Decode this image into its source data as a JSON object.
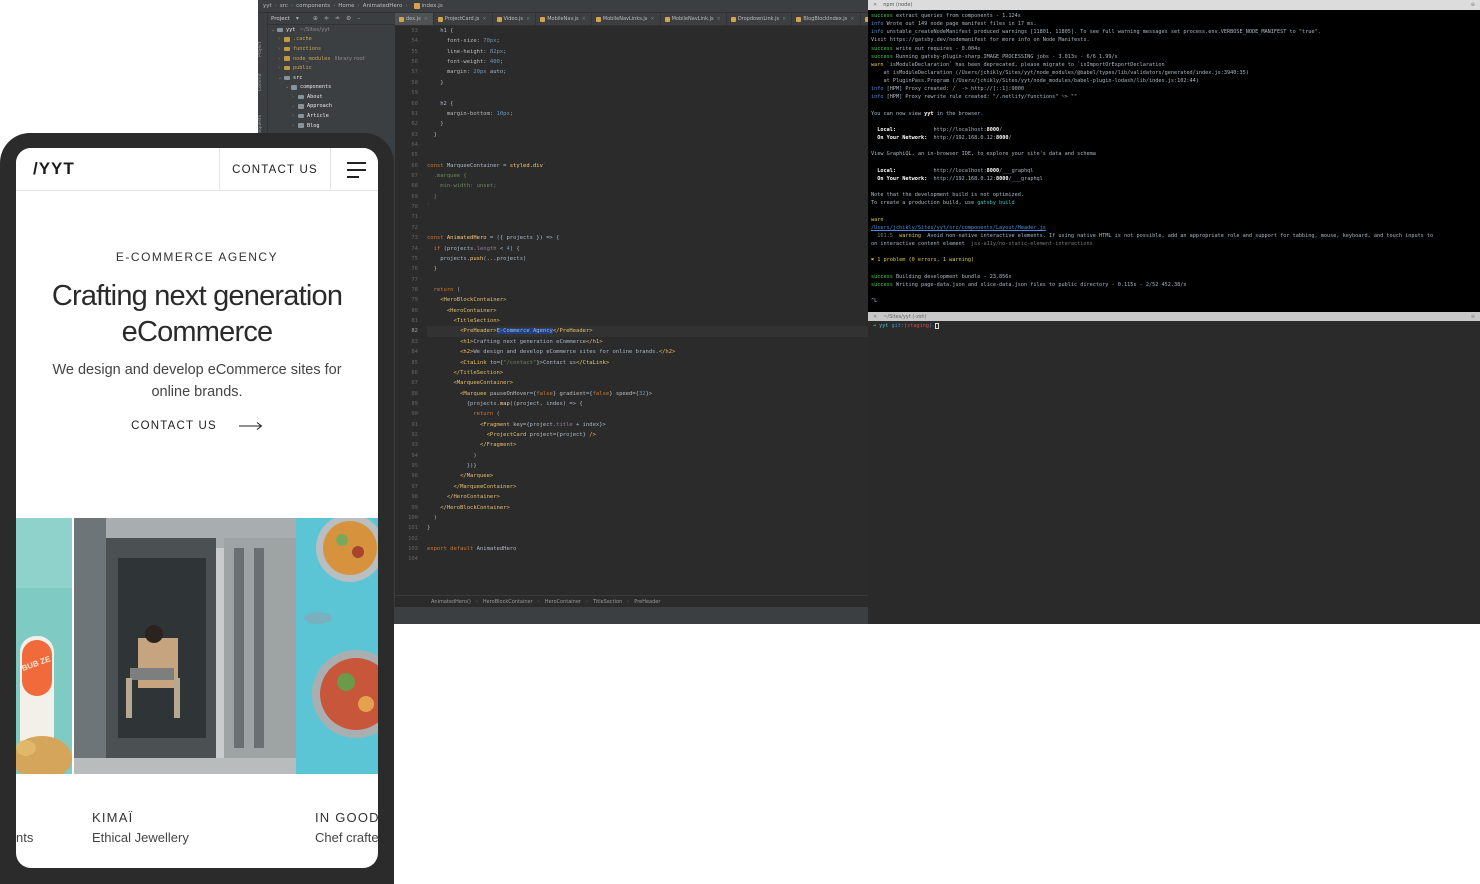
{
  "ide": {
    "breadcrumb": [
      "yyt",
      "src",
      "components",
      "Home",
      "AnimatedHero",
      "index.js"
    ],
    "strip_labels": [
      "Project",
      "Commit",
      "Pull Requests"
    ],
    "project_panel": {
      "title": "Project",
      "tree": [
        {
          "label": "yyt",
          "sub": "~/Sites/yyt",
          "indent": 0,
          "excluded": false
        },
        {
          "label": ".cache",
          "sub": "",
          "indent": 1,
          "excluded": true
        },
        {
          "label": "functions",
          "sub": "",
          "indent": 1,
          "excluded": true
        },
        {
          "label": "node_modules",
          "sub": "library root",
          "indent": 1,
          "excluded": true
        },
        {
          "label": "public",
          "sub": "",
          "indent": 1,
          "excluded": true
        },
        {
          "label": "src",
          "sub": "",
          "indent": 1,
          "excluded": false
        },
        {
          "label": "components",
          "sub": "",
          "indent": 2,
          "excluded": false
        },
        {
          "label": "About",
          "sub": "",
          "indent": 3,
          "excluded": false
        },
        {
          "label": "Approach",
          "sub": "",
          "indent": 3,
          "excluded": false
        },
        {
          "label": "Article",
          "sub": "",
          "indent": 3,
          "excluded": false
        },
        {
          "label": "Blog",
          "sub": "",
          "indent": 3,
          "excluded": false
        }
      ]
    },
    "tabs": [
      "dex.js",
      "ProjectCard.js",
      "Video.js",
      "MobileNav.js",
      "MobileNavLinks.js",
      "MobileNavLink.js",
      "DropdownLink.js",
      "BlogBlockIndex.js",
      "Ani"
    ],
    "active_tab": 0,
    "line_start": 53,
    "current_line": 82,
    "code_lines": [
      [
        [
          "pm",
          "    h1 {"
        ]
      ],
      [
        [
          "pr",
          "      font-size"
        ],
        [
          "pm",
          ": "
        ],
        [
          "nm",
          "70px"
        ],
        [
          "pm",
          ";"
        ]
      ],
      [
        [
          "pr",
          "      line-height"
        ],
        [
          "pm",
          ": "
        ],
        [
          "nm",
          "82px"
        ],
        [
          "pm",
          ";"
        ]
      ],
      [
        [
          "pr",
          "      font-weight"
        ],
        [
          "pm",
          ": "
        ],
        [
          "nm",
          "400"
        ],
        [
          "pm",
          ";"
        ]
      ],
      [
        [
          "pr",
          "      margin"
        ],
        [
          "pm",
          ": "
        ],
        [
          "nm",
          "20px"
        ],
        [
          "pm",
          " auto;"
        ]
      ],
      [
        [
          "pm",
          "    }"
        ]
      ],
      [
        [
          "pm",
          ""
        ]
      ],
      [
        [
          "pm",
          "    h2 {"
        ]
      ],
      [
        [
          "pr",
          "      margin-bottom"
        ],
        [
          "pm",
          ": "
        ],
        [
          "nm",
          "10px"
        ],
        [
          "pm",
          ";"
        ]
      ],
      [
        [
          "pm",
          "    }"
        ]
      ],
      [
        [
          "pm",
          "  }"
        ]
      ],
      [
        [
          "pm",
          ""
        ]
      ],
      [
        [
          "pm",
          ""
        ]
      ],
      [
        [
          "kw",
          "const "
        ],
        [
          "pm",
          "MarqueeContainer = "
        ],
        [
          "fn",
          "styled.div"
        ],
        [
          "st",
          "`"
        ]
      ],
      [
        [
          "st",
          "  .marquee {"
        ]
      ],
      [
        [
          "st",
          "    min-width: unset;"
        ]
      ],
      [
        [
          "st",
          "  }"
        ]
      ],
      [
        [
          "st",
          "`"
        ]
      ],
      [
        [
          "pm",
          ""
        ]
      ],
      [
        [
          "pm",
          ""
        ]
      ],
      [
        [
          "kw",
          "const "
        ],
        [
          "fn",
          "AnimatedHero"
        ],
        [
          "pm",
          " = ({ projects }) => {"
        ]
      ],
      [
        [
          "pm",
          "  "
        ],
        [
          "kw",
          "if "
        ],
        [
          "pm",
          "(projects."
        ],
        [
          "bl",
          "length"
        ],
        [
          "pm",
          " < "
        ],
        [
          "nm",
          "4"
        ],
        [
          "pm",
          ") {"
        ]
      ],
      [
        [
          "pm",
          "    projects."
        ],
        [
          "fn",
          "push"
        ],
        [
          "pm",
          "(...projects)"
        ]
      ],
      [
        [
          "pm",
          "  }"
        ]
      ],
      [
        [
          "pm",
          ""
        ]
      ],
      [
        [
          "pm",
          "  "
        ],
        [
          "kw",
          "return "
        ],
        [
          "pm",
          "("
        ]
      ],
      [
        [
          "pm",
          "    "
        ],
        [
          "tg",
          "<HeroBlockContainer>"
        ]
      ],
      [
        [
          "pm",
          "      "
        ],
        [
          "tg",
          "<HeroContainer>"
        ]
      ],
      [
        [
          "pm",
          "        "
        ],
        [
          "tg",
          "<TitleSection>"
        ]
      ],
      [
        [
          "pm",
          "          "
        ],
        [
          "tg",
          "<PreHeader>"
        ],
        [
          "hl",
          "E-Commerce Agency"
        ],
        [
          "tg",
          "</PreHeader>"
        ]
      ],
      [
        [
          "pm",
          "          "
        ],
        [
          "tg",
          "<h1>"
        ],
        [
          "pm",
          "Crafting next generation eCommerce"
        ],
        [
          "tg",
          "</h1>"
        ]
      ],
      [
        [
          "pm",
          "          "
        ],
        [
          "tg",
          "<h2>"
        ],
        [
          "pm",
          "We design and develop eCommerce sites for online brands."
        ],
        [
          "tg",
          "</h2>"
        ]
      ],
      [
        [
          "pm",
          "          "
        ],
        [
          "tg",
          "<CtaLink "
        ],
        [
          "pr",
          "to"
        ],
        [
          "pm",
          "={"
        ],
        [
          "st",
          "\"/contact\""
        ],
        [
          "pm",
          "}>"
        ],
        [
          "pm",
          "Contact us"
        ],
        [
          "tg",
          "</CtaLink>"
        ]
      ],
      [
        [
          "pm",
          "        "
        ],
        [
          "tg",
          "</TitleSection>"
        ]
      ],
      [
        [
          "pm",
          "        "
        ],
        [
          "tg",
          "<MarqueeContainer>"
        ]
      ],
      [
        [
          "pm",
          "          "
        ],
        [
          "tg",
          "<Marquee "
        ],
        [
          "pr",
          "pauseOnHover"
        ],
        [
          "pm",
          "={"
        ],
        [
          "kw",
          "false"
        ],
        [
          "pm",
          "} "
        ],
        [
          "pr",
          "gradient"
        ],
        [
          "pm",
          "={"
        ],
        [
          "kw",
          "false"
        ],
        [
          "pm",
          "} "
        ],
        [
          "pr",
          "speed"
        ],
        [
          "pm",
          "={"
        ],
        [
          "nm",
          "32"
        ],
        [
          "pm",
          "}>"
        ]
      ],
      [
        [
          "pm",
          "            {projects."
        ],
        [
          "fn",
          "map"
        ],
        [
          "pm",
          "((project, index) => {"
        ]
      ],
      [
        [
          "pm",
          "              "
        ],
        [
          "kw",
          "return "
        ],
        [
          "pm",
          "("
        ]
      ],
      [
        [
          "pm",
          "                "
        ],
        [
          "tg",
          "<Fragment "
        ],
        [
          "pr",
          "key"
        ],
        [
          "pm",
          "={project."
        ],
        [
          "bl",
          "title"
        ],
        [
          "pm",
          " + index}>"
        ]
      ],
      [
        [
          "pm",
          "                  "
        ],
        [
          "tg",
          "<ProjectCard "
        ],
        [
          "pr",
          "project"
        ],
        [
          "pm",
          "={project} "
        ],
        [
          "tg",
          "/>"
        ]
      ],
      [
        [
          "pm",
          "                "
        ],
        [
          "tg",
          "</Fragment>"
        ]
      ],
      [
        [
          "pm",
          "              )"
        ]
      ],
      [
        [
          "pm",
          "            })}"
        ]
      ],
      [
        [
          "pm",
          "          "
        ],
        [
          "tg",
          "</Marquee>"
        ]
      ],
      [
        [
          "pm",
          "        "
        ],
        [
          "tg",
          "</MarqueeContainer>"
        ]
      ],
      [
        [
          "pm",
          "      "
        ],
        [
          "tg",
          "</HeroContainer>"
        ]
      ],
      [
        [
          "pm",
          "    "
        ],
        [
          "tg",
          "</HeroBlockContainer>"
        ]
      ],
      [
        [
          "pm",
          "  )"
        ]
      ],
      [
        [
          "pm",
          "}"
        ]
      ],
      [
        [
          "pm",
          ""
        ]
      ],
      [
        [
          "kw",
          "export default "
        ],
        [
          "pm",
          "AnimatedHero"
        ]
      ],
      [
        [
          "pm",
          ""
        ]
      ]
    ],
    "status_path": [
      "AnimatedHero()",
      "HeroBlockContainer",
      "HeroContainer",
      "TitleSection",
      "PreHeader"
    ]
  },
  "terminal": {
    "title": "npm (node)",
    "lines": [
      [
        [
          "gr",
          "success"
        ],
        [
          "pm",
          " extract queries from components - 1.124s"
        ]
      ],
      [
        [
          "bl2",
          "info"
        ],
        [
          "pm",
          " Wrote out 149 node page manifest files in 17 ms."
        ]
      ],
      [
        [
          "bl2",
          "info"
        ],
        [
          "pm",
          " unstable_createNodeManifest produced warnings [11801, 11805]. To see full warning messages set process.env.VERBOSE_NODE_MANIFEST to \"true\"."
        ]
      ],
      [
        [
          "pm",
          "Visit https://gatsby.dev/nodemanifest for more info on Node Manifests."
        ]
      ],
      [
        [
          "gr",
          "success"
        ],
        [
          "pm",
          " write out requires - 0.004s"
        ]
      ],
      [
        [
          "gr",
          "success"
        ],
        [
          "pm",
          " Running gatsby-plugin-sharp.IMAGE_PROCESSING jobs - 3.013s - 6/6 1.99/s"
        ]
      ],
      [
        [
          "ye",
          "warn"
        ],
        [
          "pm",
          " `isModuleDeclaration` has been deprecated, please migrate to `isImportOrExportDeclaration`"
        ]
      ],
      [
        [
          "pm",
          "    at isModuleDeclaration (/Users/jchikly/Sites/yyt/node_modules/@babel/types/lib/validators/generated/index.js:3940:35)"
        ]
      ],
      [
        [
          "pm",
          "    at PluginPass.Program (/Users/jchikly/Sites/yyt/node_modules/babel-plugin-lodash/lib/index.js:102:44)"
        ]
      ],
      [
        [
          "bl2",
          "info"
        ],
        [
          "pm",
          " [HPM] Proxy created: /  -> http://[::1]:9000"
        ]
      ],
      [
        [
          "bl2",
          "info"
        ],
        [
          "pm",
          " [HPM] Proxy rewrite rule created: \"/.netlify/functions\" ~> \"\""
        ]
      ],
      [
        [
          "pm",
          ""
        ]
      ],
      [
        [
          "pm",
          "You can now view "
        ],
        [
          "bd",
          "yyt"
        ],
        [
          "pm",
          " in the browser."
        ]
      ],
      [
        [
          "pm",
          ""
        ]
      ],
      [
        [
          "pm",
          "  "
        ],
        [
          "bd",
          "Local:"
        ],
        [
          "pm",
          "            http://localhost:"
        ],
        [
          "bd",
          "8000"
        ],
        [
          "pm",
          "/"
        ]
      ],
      [
        [
          "pm",
          "  "
        ],
        [
          "bd",
          "On Your Network:"
        ],
        [
          "pm",
          "  http://192.168.0.12:"
        ],
        [
          "bd",
          "8000"
        ],
        [
          "pm",
          "/"
        ]
      ],
      [
        [
          "pm",
          ""
        ]
      ],
      [
        [
          "pm",
          "View GraphiQL, an in-browser IDE, to explore your site's data and schema"
        ]
      ],
      [
        [
          "pm",
          ""
        ]
      ],
      [
        [
          "pm",
          "  "
        ],
        [
          "bd",
          "Local:"
        ],
        [
          "pm",
          "            http://localhost:"
        ],
        [
          "bd",
          "8000"
        ],
        [
          "pm",
          "/___graphql"
        ]
      ],
      [
        [
          "pm",
          "  "
        ],
        [
          "bd",
          "On Your Network:"
        ],
        [
          "pm",
          "  http://192.168.0.12:"
        ],
        [
          "bd",
          "8000"
        ],
        [
          "pm",
          "/___graphql"
        ]
      ],
      [
        [
          "pm",
          ""
        ]
      ],
      [
        [
          "pm",
          "Note that the development build is not optimized."
        ]
      ],
      [
        [
          "pm",
          "To create a production build, use "
        ],
        [
          "cy",
          "gatsby build"
        ]
      ],
      [
        [
          "pm",
          ""
        ]
      ],
      [
        [
          "ye",
          "warn"
        ]
      ],
      [
        [
          "ul",
          "/Users/jchikly/Sites/yyt/src/components/Layout/Header.js"
        ]
      ],
      [
        [
          "dim",
          "  161:5"
        ],
        [
          "ye",
          "  warning"
        ],
        [
          "pm",
          "  Avoid non-native interactive elements. If using native HTML is not possible, add an appropriate role and support for tabbing, mouse, keyboard, and touch inputs to"
        ]
      ],
      [
        [
          "pm",
          "on interactive content element  "
        ],
        [
          "dim",
          "jsx-a11y/no-static-element-interactions"
        ]
      ],
      [
        [
          "pm",
          ""
        ]
      ],
      [
        [
          "ye",
          "✖ 1 problem (0 errors, 1 warning)"
        ]
      ],
      [
        [
          "pm",
          ""
        ]
      ],
      [
        [
          "gr",
          "success"
        ],
        [
          "pm",
          " Building development bundle - 23.856s"
        ]
      ],
      [
        [
          "gr",
          "success"
        ],
        [
          "pm",
          " Writing page-data.json and slice-data.json files to public directory - 0.115s - 2/52 452.38/s"
        ]
      ],
      [
        [
          "pm",
          ""
        ]
      ],
      [
        [
          "pm",
          "^L"
        ]
      ]
    ],
    "pane2_title": "~/Sites/yyt (-zsh)",
    "prompt": {
      "arrow": "➜",
      "dir": "yyt",
      "git_label": "git:(",
      "branch": "staging",
      "git_close": ")"
    }
  },
  "phone": {
    "logo": "/YYT",
    "header_contact": "CONTACT US",
    "eyebrow": "E-COMMERCE AGENCY",
    "headline": "Crafting next generation eCommerce",
    "subtitle": "We design and develop eCommerce sites for online brands.",
    "cta": "CONTACT US",
    "cards": [
      {
        "title": "",
        "sub": "nts"
      },
      {
        "title": "KIMAÏ",
        "sub": "Ethical Jewellery"
      },
      {
        "title": "IN GOOD",
        "sub": "Chef crafte"
      }
    ],
    "bottle_label": "BUB ZE"
  },
  "colors": {
    "ide_bg": "#2b2b2b",
    "ide_panel": "#3c3f41",
    "terminal_bg": "#000000",
    "phone_frame": "#2b2b2b"
  }
}
